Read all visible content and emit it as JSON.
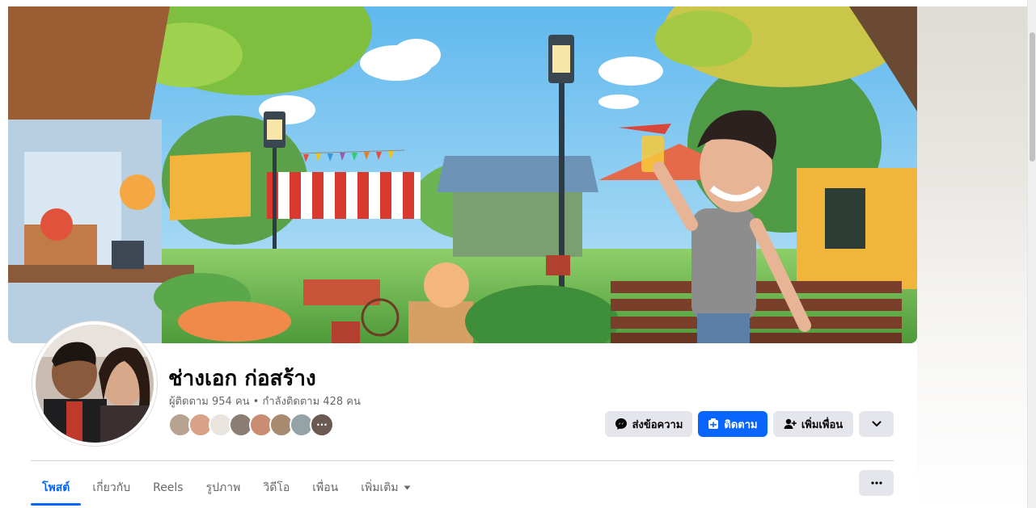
{
  "profile": {
    "name": "ช่างเอก ก่อสร้าง",
    "followers_label": "ผู้ติดตาม",
    "followers_count": "954",
    "followers_unit": "คน",
    "separator": "•",
    "following_label": "กำลังติดตาม",
    "following_count": "428",
    "following_unit": "คน"
  },
  "actions": {
    "message_label": "ส่งข้อความ",
    "follow_label": "ติดตาม",
    "add_friend_label": "เพิ่มเพื่อน"
  },
  "tabs": [
    {
      "label": "โพสต์",
      "active": true
    },
    {
      "label": "เกี่ยวกับ"
    },
    {
      "label": "Reels"
    },
    {
      "label": "รูปภาพ"
    },
    {
      "label": "วิดีโอ"
    },
    {
      "label": "เพื่อน"
    },
    {
      "label": "เพิ่มเติม"
    }
  ],
  "icons": {
    "message": "messenger-icon",
    "follow": "follow-icon",
    "add_friend": "add-friend-icon",
    "dropdown": "chevron-down-icon",
    "more": "more-options-icon"
  },
  "colors": {
    "brand": "#0866ff",
    "button_gray": "#e4e6eb",
    "secondary_text": "#65676b"
  }
}
